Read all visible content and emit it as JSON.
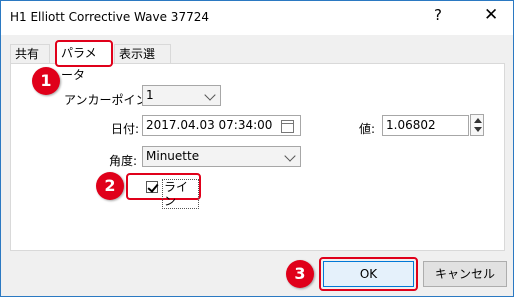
{
  "window": {
    "title": "H1 Elliott Corrective Wave 37724",
    "help_symbol": "?",
    "close_symbol": "✕"
  },
  "tabs": [
    {
      "label": "共有",
      "selected": false
    },
    {
      "label": "パラメータ",
      "selected": true
    },
    {
      "label": "表示選択",
      "selected": false
    }
  ],
  "fields": {
    "anchor_label": "アンカーポイント:",
    "anchor_value": "1",
    "date_label": "日付:",
    "date_value": "2017.04.03 07:34:00",
    "value_label": "値:",
    "value_value": "1.06802",
    "angle_label": "角度:",
    "angle_value": "Minuette",
    "line_label": "ライン",
    "line_checked": true
  },
  "buttons": {
    "ok": "OK",
    "cancel": "キャンセル"
  },
  "annotations": [
    "1",
    "2",
    "3"
  ],
  "colors": {
    "highlight": "#e0001a",
    "accent": "#0078d7",
    "title_border": "#2b79c2"
  }
}
